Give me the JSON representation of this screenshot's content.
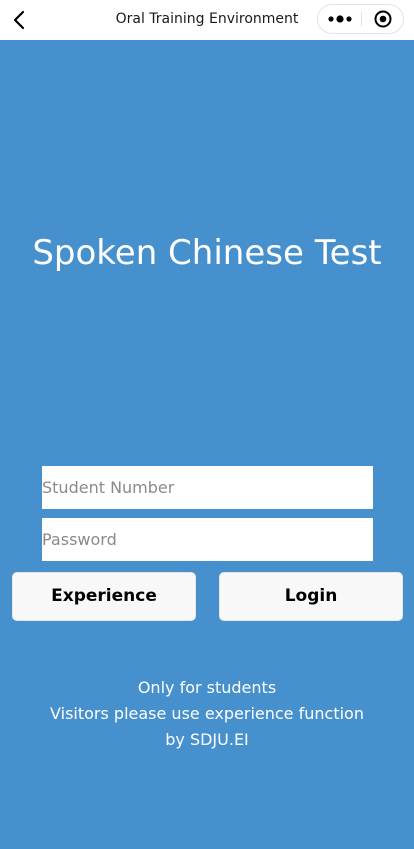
{
  "nav": {
    "title": "Oral Training Environment",
    "back_icon": "chevron-left-icon",
    "more_icon": "more-dots-icon",
    "close_icon": "target-close-icon"
  },
  "main": {
    "title": "Spoken Chinese Test"
  },
  "form": {
    "student_number": {
      "value": "",
      "placeholder": "Student Number"
    },
    "password": {
      "value": "",
      "placeholder": "Password"
    },
    "experience_label": "Experience",
    "login_label": "Login"
  },
  "footer": {
    "line1": "Only for students",
    "line2": "Visitors please use experience function",
    "line3": "by SDJU.EI"
  },
  "colors": {
    "background": "#4690CD",
    "top_bar": "#FFFFFF",
    "button_bg": "#F8F8F8",
    "text_on_bg": "#FFFFFF"
  }
}
